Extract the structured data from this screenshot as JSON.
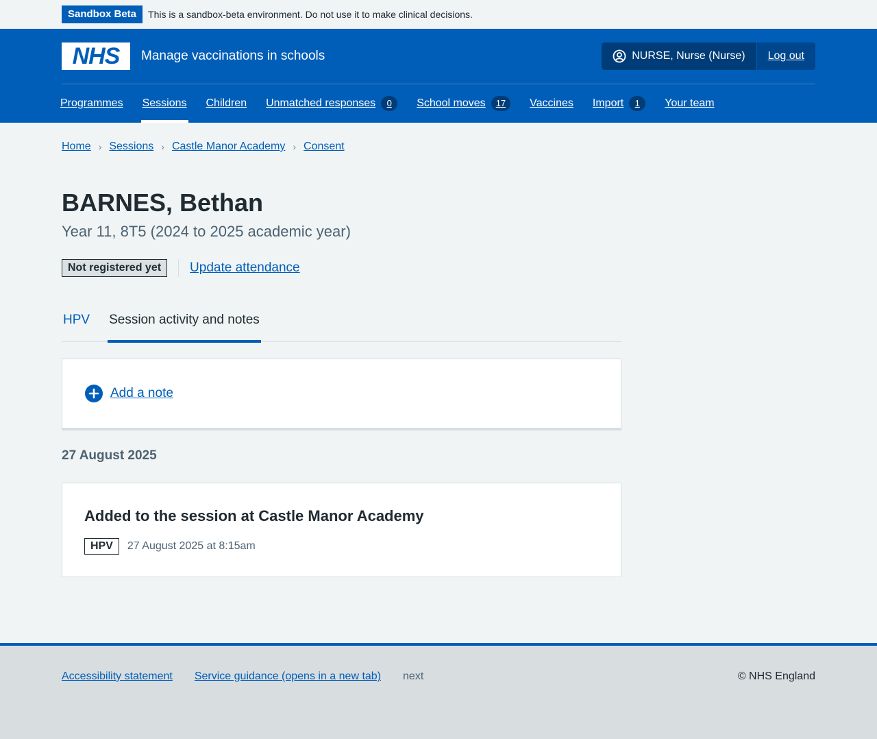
{
  "banner": {
    "tag": "Sandbox Beta",
    "text": "This is a sandbox-beta environment. Do not use it to make clinical decisions."
  },
  "header": {
    "logo": "NHS",
    "service_name": "Manage vaccinations in schools",
    "user": "NURSE, Nurse (Nurse)",
    "logout": "Log out",
    "user_icon": "user-circle-icon"
  },
  "nav": {
    "items": [
      {
        "label": "Programmes"
      },
      {
        "label": "Sessions",
        "active": true
      },
      {
        "label": "Children"
      },
      {
        "label": "Unmatched responses",
        "count": "0"
      },
      {
        "label": "School moves",
        "count": "17"
      },
      {
        "label": "Vaccines"
      },
      {
        "label": "Import",
        "count": "1"
      },
      {
        "label": "Your team"
      }
    ]
  },
  "breadcrumb": [
    "Home",
    "Sessions",
    "Castle Manor Academy",
    "Consent"
  ],
  "patient": {
    "name": "BARNES, Bethan",
    "caption": "Year 11, 8T5 (2024 to 2025 academic year)",
    "status": "Not registered yet",
    "update_link": "Update attendance"
  },
  "tabs": {
    "items": [
      "HPV",
      "Session activity and notes"
    ],
    "selected": "Session activity and notes"
  },
  "notes": {
    "add_label": "Add a note",
    "add_icon": "plus-circle-icon"
  },
  "activity": {
    "date": "27 August 2025",
    "events": [
      {
        "title": "Added to the session at Castle Manor Academy",
        "programme": "HPV",
        "time": "27 August 2025 at 8:15am"
      }
    ]
  },
  "footer": {
    "links": [
      "Accessibility statement",
      "Service guidance (opens in a new tab)"
    ],
    "version": "next",
    "copyright": "© NHS England"
  },
  "colors": {
    "primary": "#005eb8",
    "dark_blue": "#003d78",
    "background": "#f0f4f5",
    "text": "#212b32",
    "secondary_text": "#4c6272"
  }
}
